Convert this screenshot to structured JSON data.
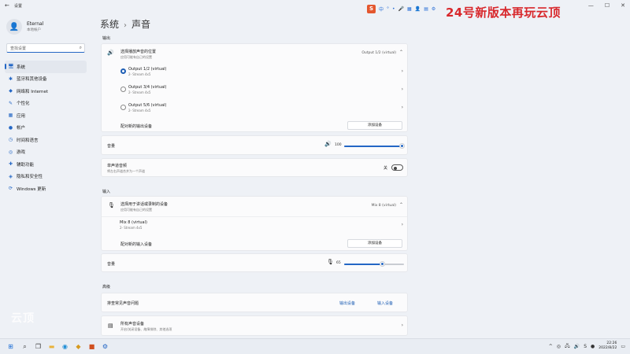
{
  "window": {
    "title": "设置",
    "back_glyph": "←",
    "min_glyph": "—",
    "max_glyph": "☐",
    "close_glyph": "✕"
  },
  "overlay": {
    "logo": "S",
    "tools": [
      "中",
      "°",
      "•",
      "🎤",
      "▦",
      "👤",
      "▤",
      "⚙"
    ],
    "banner": "24号新版本再玩云顶"
  },
  "profile": {
    "name": "Eternal",
    "subtitle": "本地帐户"
  },
  "search": {
    "placeholder": "查找设置"
  },
  "nav": [
    {
      "label": "系统",
      "icon": "🖥",
      "active": true
    },
    {
      "label": "蓝牙和其他设备",
      "icon": "✱",
      "active": false
    },
    {
      "label": "网络和 Internet",
      "icon": "◆",
      "active": false
    },
    {
      "label": "个性化",
      "icon": "✎",
      "active": false
    },
    {
      "label": "应用",
      "icon": "▦",
      "active": false
    },
    {
      "label": "帐户",
      "icon": "●",
      "active": false
    },
    {
      "label": "时间和语言",
      "icon": "◷",
      "active": false
    },
    {
      "label": "游戏",
      "icon": "◎",
      "active": false
    },
    {
      "label": "辅助功能",
      "icon": "✚",
      "active": false
    },
    {
      "label": "隐私和安全性",
      "icon": "◈",
      "active": false
    },
    {
      "label": "Windows 更新",
      "icon": "⟳",
      "active": false
    }
  ],
  "breadcrumb": {
    "parent": "系统",
    "sep": "›",
    "current": "声音"
  },
  "output": {
    "section": "输出",
    "choose_title": "选择播放声音的位置",
    "choose_sub": "应用可能有自己的设置",
    "selected": "Output 1/2 (virtual)",
    "devices": [
      {
        "name": "Output 1/2 (virtual)",
        "sub": "2- Stream 4x5",
        "selected": true
      },
      {
        "name": "Output 3/4 (virtual)",
        "sub": "2- Stream 4x5",
        "selected": false
      },
      {
        "name": "Output 5/6 (virtual)",
        "sub": "2- Stream 4x5",
        "selected": false
      }
    ],
    "pair_label": "配对新的输出设备",
    "add_button": "添加设备",
    "volume_label": "音量",
    "volume_value": "100",
    "volume_level": 1.0,
    "mono_title": "单声道音频",
    "mono_sub": "将左右声道合并为一个声道",
    "mono_state": "关"
  },
  "input": {
    "section": "输入",
    "choose_title": "选择用于讲话或录制的设备",
    "choose_sub": "应用可能有自己的设置",
    "selected": "Mix 8 (virtual)",
    "device": {
      "name": "Mix 8 (virtual)",
      "sub": "2- Stream 4x5"
    },
    "pair_label": "配对新的输入设备",
    "add_button": "添加设备",
    "volume_label": "音量",
    "volume_value": "65",
    "volume_level": 0.65
  },
  "advanced": {
    "section": "高级",
    "troubleshoot_label": "排查常见声音问题",
    "output_devices_link": "输出设备",
    "input_devices_link": "输入设备",
    "all_devices_title": "所有声音设备",
    "all_devices_sub": "开启/关闭设备、故障排除、其他选项"
  },
  "watermark": "云顶",
  "taskbar": {
    "tray_up": "^",
    "clock_time": "22:26",
    "clock_date": "2022/8/22"
  },
  "colors": {
    "accent": "#2467c5",
    "banner_red": "#d8282c"
  }
}
